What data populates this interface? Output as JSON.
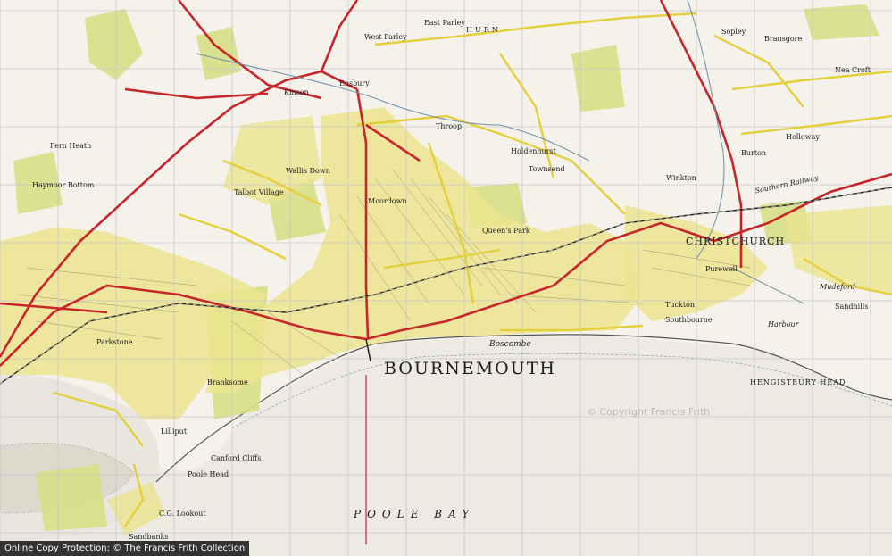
{
  "map": {
    "towns": {
      "bournemouth": "BOURNEMOUTH",
      "christchurch": "CHRISTCHURCH",
      "hengistbury": "HENGISTBURY HEAD"
    },
    "places": [
      {
        "id": "west-parley",
        "text": "West Parley"
      },
      {
        "id": "east-parley",
        "text": "East Parley"
      },
      {
        "id": "hurn",
        "text": "HURN"
      },
      {
        "id": "sopley",
        "text": "Sopley"
      },
      {
        "id": "bransgore",
        "text": "Bransgore"
      },
      {
        "id": "neacroft",
        "text": "Nea Croft"
      },
      {
        "id": "boscombe",
        "text": "Boscombe"
      },
      {
        "id": "southbourne",
        "text": "Southbourne"
      },
      {
        "id": "tuckton",
        "text": "Tuckton"
      },
      {
        "id": "parkstone",
        "text": "Parkstone"
      },
      {
        "id": "branksome",
        "text": "Branksome"
      },
      {
        "id": "lilliput",
        "text": "Lilliput"
      },
      {
        "id": "sandbanks",
        "text": "Sandbanks"
      },
      {
        "id": "talbot-village",
        "text": "Talbot Village"
      },
      {
        "id": "wallisdown",
        "text": "Wallis Down"
      },
      {
        "id": "moordown",
        "text": "Moordown"
      },
      {
        "id": "kinson",
        "text": "Kinson"
      },
      {
        "id": "ensbury",
        "text": "Ensbury"
      },
      {
        "id": "throop",
        "text": "Throop"
      },
      {
        "id": "holdenhurst",
        "text": "Holdenhurst"
      },
      {
        "id": "townsend",
        "text": "Townsend"
      },
      {
        "id": "burton",
        "text": "Burton"
      },
      {
        "id": "winkton",
        "text": "Winkton"
      },
      {
        "id": "purewell",
        "text": "Purewell"
      },
      {
        "id": "mudeford",
        "text": "Mudeford"
      },
      {
        "id": "queens-park",
        "text": "Queen's Park"
      },
      {
        "id": "harbour",
        "text": "Harbour"
      },
      {
        "id": "poole-head",
        "text": "Poole Head"
      },
      {
        "id": "canford-cliffs",
        "text": "Canford Cliffs"
      },
      {
        "id": "cg-lookout",
        "text": "C.G. Lookout"
      },
      {
        "id": "haymoor",
        "text": "Haymoor Bottom"
      },
      {
        "id": "fernheath",
        "text": "Fern Heath"
      },
      {
        "id": "holloway",
        "text": "Holloway"
      },
      {
        "id": "sandhills",
        "text": "Sandhills"
      },
      {
        "id": "southern-railway",
        "text": "Southern Railway"
      }
    ],
    "sea": {
      "bay": "POOLE BAY"
    },
    "watermark": "© Copyright Francis Frith",
    "credit": "Online Copy Protection: © The Francis Frith Collection",
    "colors": {
      "paper": "#f4f2ea",
      "sea": "#eceae3",
      "urban": "#ebe48e",
      "main_road": "#c8252b",
      "minor_road": "#e4cf3c",
      "woodland": "#d7df86",
      "grid": "#c7c7c7",
      "text": "#1c1c1c"
    }
  }
}
